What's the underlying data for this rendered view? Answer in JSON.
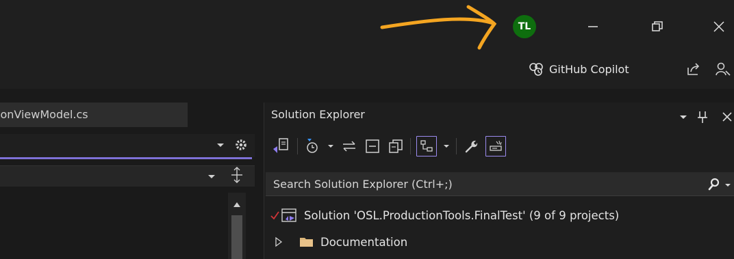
{
  "titlebar": {
    "avatar_initials": "TL",
    "avatar_color": "#0e6e0e",
    "annotation_color": "#f4a521"
  },
  "toolbar": {
    "copilot_label": "GitHub Copilot"
  },
  "editor": {
    "tab_label": "ionViewModel.cs",
    "accent_color": "#7e71d6"
  },
  "solution_explorer": {
    "title": "Solution Explorer",
    "search_placeholder": "Search Solution Explorer (Ctrl+;)",
    "tree": [
      {
        "label": "Solution 'OSL.ProductionTools.FinalTest' (9 of 9 projects)",
        "icon": "solution-icon",
        "status": "check-icon"
      },
      {
        "label": "Documentation",
        "icon": "folder-icon",
        "expander": "chevron-right-icon"
      }
    ]
  }
}
